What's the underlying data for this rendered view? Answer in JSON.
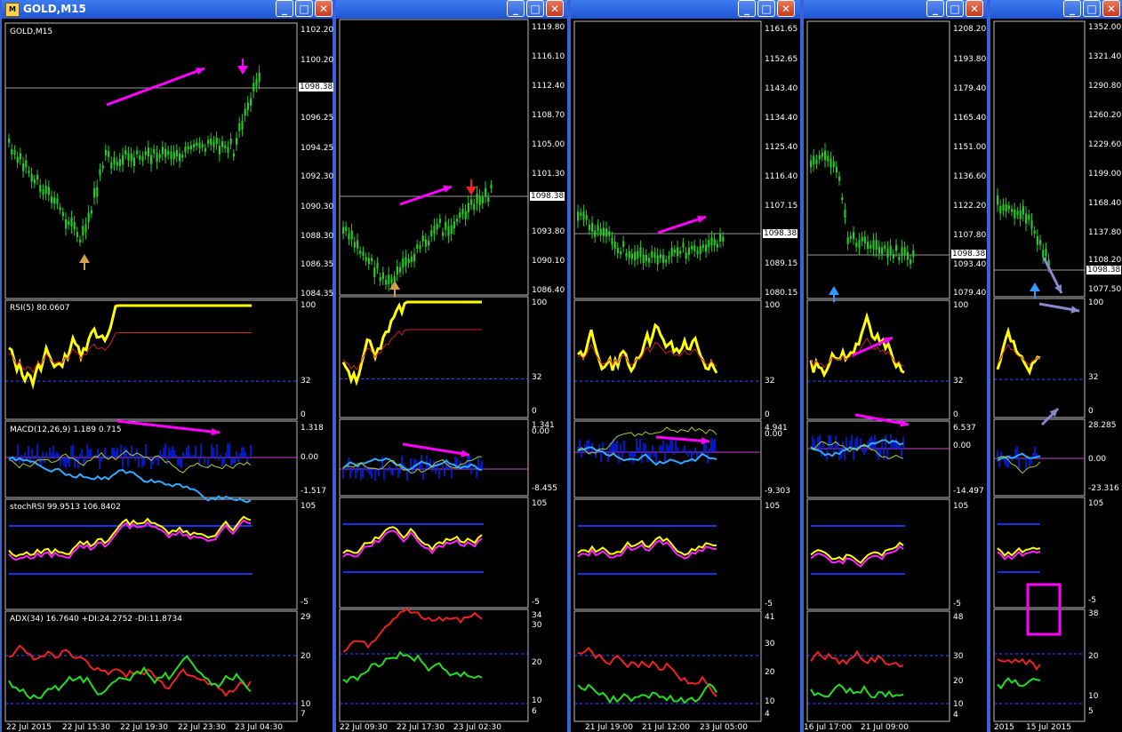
{
  "window1": {
    "title": "GOLD,M15",
    "chart_label": "GOLD,M15",
    "prices": [
      "1102.20",
      "1100.20",
      "1096.25",
      "1094.25",
      "1092.30",
      "1090.30",
      "1088.30",
      "1086.35",
      "1084.35"
    ],
    "current_price": "1098.38",
    "rsi_label": "RSI(5) 80.0607",
    "rsi_scale": [
      "100",
      "32",
      "0"
    ],
    "macd_label": "MACD(12,26,9) 1.189 0.715",
    "macd_scale": [
      "1.318",
      "0.00",
      "-1.517"
    ],
    "stoch_label": "stochRSI 99.9513 106.8402",
    "stoch_scale": [
      "105",
      "-5"
    ],
    "adx_label": "ADX(34) 16.7640 +DI:24.2752 -DI:11.8734",
    "adx_scale": [
      "29",
      "20",
      "10",
      "7"
    ],
    "dates": [
      "22 Jul 2015",
      "22 Jul 15:30",
      "22 Jul 19:30",
      "22 Jul 23:30",
      "23 Jul 04:30"
    ]
  },
  "window2": {
    "prices": [
      "1119.80",
      "1116.10",
      "1112.40",
      "1108.70",
      "1105.00",
      "1101.30",
      "1097.50",
      "1093.80",
      "1090.10",
      "1086.40"
    ],
    "current_price": "1098.38",
    "rsi_scale": [
      "100",
      "32",
      "0"
    ],
    "macd_scale": [
      "1.341",
      "0.00",
      "-8.455"
    ],
    "stoch_scale": [
      "105",
      "-5"
    ],
    "adx_scale": [
      "34",
      "30",
      "20",
      "10",
      "6"
    ],
    "dates": [
      "22 Jul 09:30",
      "22 Jul 17:30",
      "23 Jul 02:30"
    ]
  },
  "window3": {
    "prices": [
      "1161.65",
      "1152.65",
      "1143.40",
      "1134.40",
      "1125.40",
      "1116.40",
      "1107.15",
      "1098.15",
      "1089.15",
      "1080.15"
    ],
    "current_price": "1098.38",
    "rsi_scale": [
      "100",
      "32",
      "0"
    ],
    "macd_scale": [
      "4.941",
      "0.00",
      "-9.303"
    ],
    "stoch_scale": [
      "105",
      "-5"
    ],
    "adx_scale": [
      "41",
      "30",
      "20",
      "10",
      "4"
    ],
    "dates": [
      "21 Jul 19:00",
      "21 Jul 12:00",
      "23 Jul 05:00"
    ]
  },
  "window4": {
    "prices": [
      "1208.20",
      "1193.80",
      "1179.40",
      "1165.40",
      "1151.00",
      "1136.60",
      "1122.20",
      "1107.80",
      "1093.40",
      "1079.40"
    ],
    "current_price": "1098.38",
    "rsi_scale": [
      "100",
      "32",
      "0"
    ],
    "macd_scale": [
      "6.537",
      "0.00",
      "-14.497"
    ],
    "stoch_scale": [
      "105",
      "-5"
    ],
    "adx_scale": [
      "48",
      "30",
      "20",
      "10",
      "4"
    ],
    "dates": [
      "16 Jul 17:00",
      "21 Jul 09:00"
    ]
  },
  "window5": {
    "prices": [
      "1352.00",
      "1321.40",
      "1290.80",
      "1260.20",
      "1229.60",
      "1199.00",
      "1168.40",
      "1137.80",
      "1108.20",
      "1077.50"
    ],
    "current_price": "1098.38",
    "rsi_scale": [
      "100",
      "32",
      "0"
    ],
    "macd_scale": [
      "28.285",
      "0.00",
      "-23.316"
    ],
    "stoch_scale": [
      "105",
      "-5"
    ],
    "adx_scale": [
      "38",
      "20",
      "10",
      "5"
    ],
    "dates": [
      "2015",
      "15 Jul 2015"
    ]
  },
  "colors": {
    "bull_candle": "#22cc22",
    "rsi": "#ffff00",
    "annotation": "#ff00ff",
    "macd_hist": "#0022ff",
    "adx_plus": "#22dd22",
    "adx_minus": "#ee2222"
  }
}
